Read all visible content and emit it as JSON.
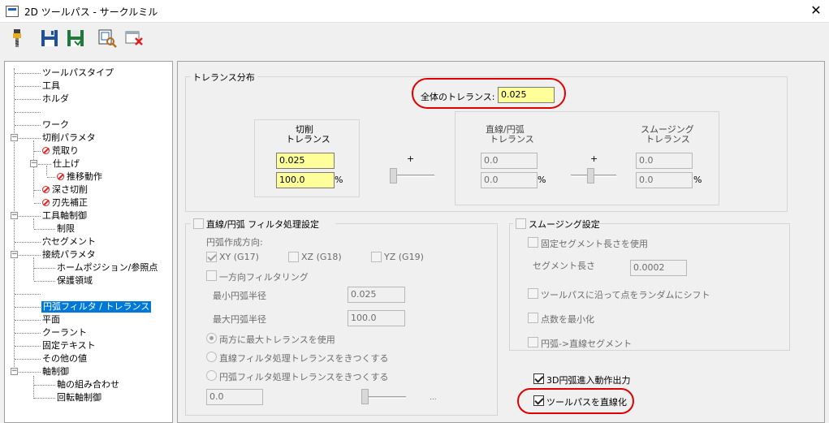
{
  "window": {
    "title": "2D ツールパス - サークルミル"
  },
  "toolbar": {
    "icons": [
      "tool-icon",
      "save-icon",
      "save-as-icon",
      "preview-icon",
      "delete-icon"
    ]
  },
  "tree": {
    "items": [
      {
        "label": "ツールパスタイプ"
      },
      {
        "label": "工具"
      },
      {
        "label": "ホルダ"
      },
      {
        "label": ""
      },
      {
        "label": "ワーク"
      },
      {
        "label": "切削パラメタ"
      },
      {
        "label": "荒取り"
      },
      {
        "label": "仕上げ"
      },
      {
        "label": "推移動作"
      },
      {
        "label": "深さ切削"
      },
      {
        "label": "刃先補正"
      },
      {
        "label": "工具軸制御"
      },
      {
        "label": "制限"
      },
      {
        "label": "穴セグメント"
      },
      {
        "label": "接続パラメタ"
      },
      {
        "label": "ホームポジション/参照点"
      },
      {
        "label": "保護領域"
      },
      {
        "label": ""
      },
      {
        "label": "円弧フィルタ / トレランス"
      },
      {
        "label": "平面"
      },
      {
        "label": "クーラント"
      },
      {
        "label": "固定テキスト"
      },
      {
        "label": "その他の値"
      },
      {
        "label": "軸制御"
      },
      {
        "label": "軸の組み合わせ"
      },
      {
        "label": "回転軸制御"
      }
    ]
  },
  "tolerance": {
    "group_label": "トレランス分布",
    "total_label": "全体のトレランス:",
    "total_value": "0.025",
    "cut_label_1": "切削",
    "cut_label_2": "トレランス",
    "cut_value": "0.025",
    "cut_percent": "100.0",
    "line_arc_label_1": "直線/円弧",
    "line_arc_label_2": "トレランス",
    "line_arc_value": "0.0",
    "line_arc_percent": "0.0",
    "smooth_label_1": "スムージング",
    "smooth_label_2": "トレランス",
    "smooth_value": "0.0",
    "smooth_percent": "0.0",
    "plus": "+",
    "percent": "%"
  },
  "arc_filter": {
    "group_label": "直線/円弧 フィルタ処理設定",
    "direction_label": "円弧作成方向:",
    "xy": "XY (G17)",
    "xz": "XZ (G18)",
    "yz": "YZ (G19)",
    "one_way": "一方向フィルタリング",
    "min_radius_label": "最小円弧半径",
    "min_radius_value": "0.025",
    "max_radius_label": "最大円弧半径",
    "max_radius_value": "100.0",
    "radio_both": "両方に最大トレランスを使用",
    "radio_line": "直線フィルタ処理トレランスをきつくする",
    "radio_arc": "円弧フィルタ処理トレランスをきつくする",
    "bottom_value": "0.0",
    "ellipsis": "..."
  },
  "smoothing": {
    "group_label": "スムージング設定",
    "fixed_segment": "固定セグメント長さを使用",
    "segment_length_label": "セグメント長さ",
    "segment_length_value": "0.0002",
    "random_shift": "ツールパスに沿って点をランダムにシフト",
    "minimize_points": "点数を最小化",
    "arc_to_line": "円弧->直線セグメント"
  },
  "options": {
    "arc_3d": "3D円弧進入動作出力",
    "linearize": "ツールパスを直線化"
  }
}
